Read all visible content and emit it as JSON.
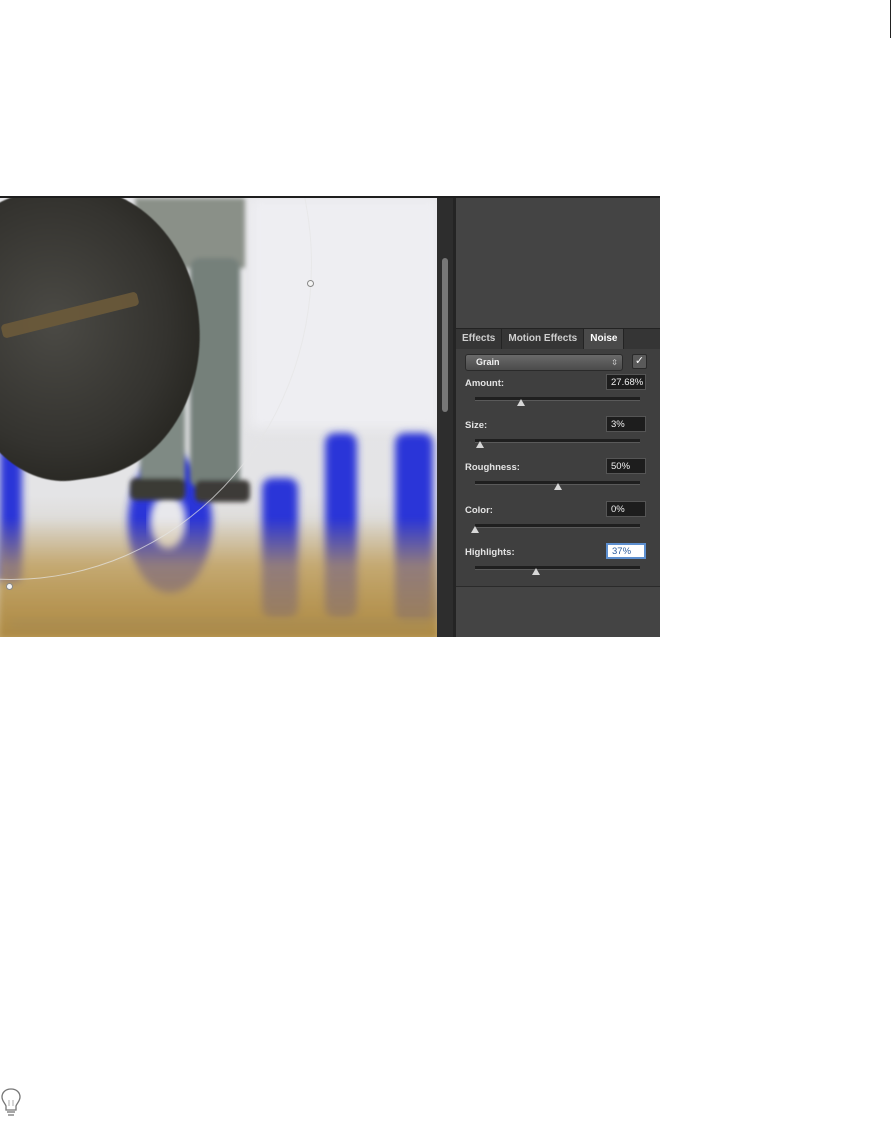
{
  "panel": {
    "tabs": [
      {
        "label": "Effects",
        "active": false
      },
      {
        "label": "Motion Effects",
        "active": false
      },
      {
        "label": "Noise",
        "active": true
      }
    ],
    "noise": {
      "preset": "Grain",
      "enabled": true,
      "params": [
        {
          "label": "Amount:",
          "value": "27.68%",
          "level": 0.2768
        },
        {
          "label": "Size:",
          "value": "3%",
          "level": 0.03
        },
        {
          "label": "Roughness:",
          "value": "50%",
          "level": 0.5
        },
        {
          "label": "Color:",
          "value": "0%",
          "level": 0.0
        },
        {
          "label": "Highlights:",
          "value": "37%",
          "level": 0.37,
          "focused": true
        }
      ]
    }
  },
  "icons": {
    "checkbox": "checkmark-icon",
    "dropdown_arrows": "up-down-chevron-icon",
    "tip": "lightbulb-icon"
  },
  "colors": {
    "panel_bg": "#444444",
    "focus_border": "#5d8fcf",
    "photo_blue_text": "#2b35d8"
  }
}
